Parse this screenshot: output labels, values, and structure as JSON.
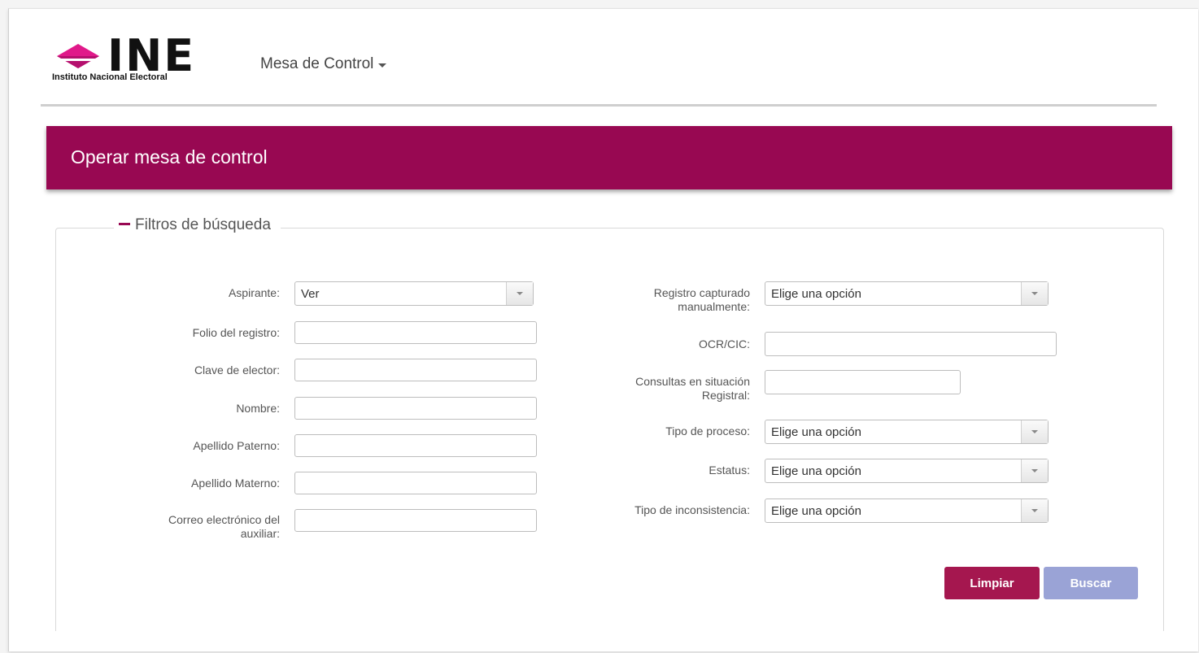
{
  "header": {
    "logo_text": "INE",
    "logo_subtitle": "Instituto Nacional Electoral",
    "nav_menu_label": "Mesa de Control"
  },
  "banner": {
    "title": "Operar mesa de control"
  },
  "filters": {
    "legend": "Filtros de búsqueda",
    "left": {
      "aspirante": {
        "label": "Aspirante:",
        "value": "Ver"
      },
      "folio": {
        "label": "Folio del registro:",
        "value": ""
      },
      "clave": {
        "label": "Clave de elector:",
        "value": ""
      },
      "nombre": {
        "label": "Nombre:",
        "value": ""
      },
      "paterno": {
        "label": "Apellido Paterno:",
        "value": ""
      },
      "materno": {
        "label": "Apellido Materno:",
        "value": ""
      },
      "correo": {
        "label_line1": "Correo electrónico del",
        "label_line2": "auxiliar:",
        "value": ""
      }
    },
    "right": {
      "registro": {
        "label_line1": "Registro capturado",
        "label_line2": "manualmente:",
        "value": "Elige una opción"
      },
      "ocr": {
        "label": "OCR/CIC:",
        "value": ""
      },
      "consultas": {
        "label_line1": "Consultas en situación",
        "label_line2": "Registral:",
        "value": ""
      },
      "tipo_proceso": {
        "label": "Tipo de proceso:",
        "value": "Elige una opción"
      },
      "estatus": {
        "label": "Estatus:",
        "value": "Elige una opción"
      },
      "tipo_inconsistencia": {
        "label": "Tipo de inconsistencia:",
        "value": "Elige una opción"
      }
    }
  },
  "actions": {
    "clear_label": "Limpiar",
    "search_label": "Buscar"
  },
  "colors": {
    "brand": "#980852",
    "clear_button": "#a5174f",
    "search_button": "#9aa3d6"
  }
}
